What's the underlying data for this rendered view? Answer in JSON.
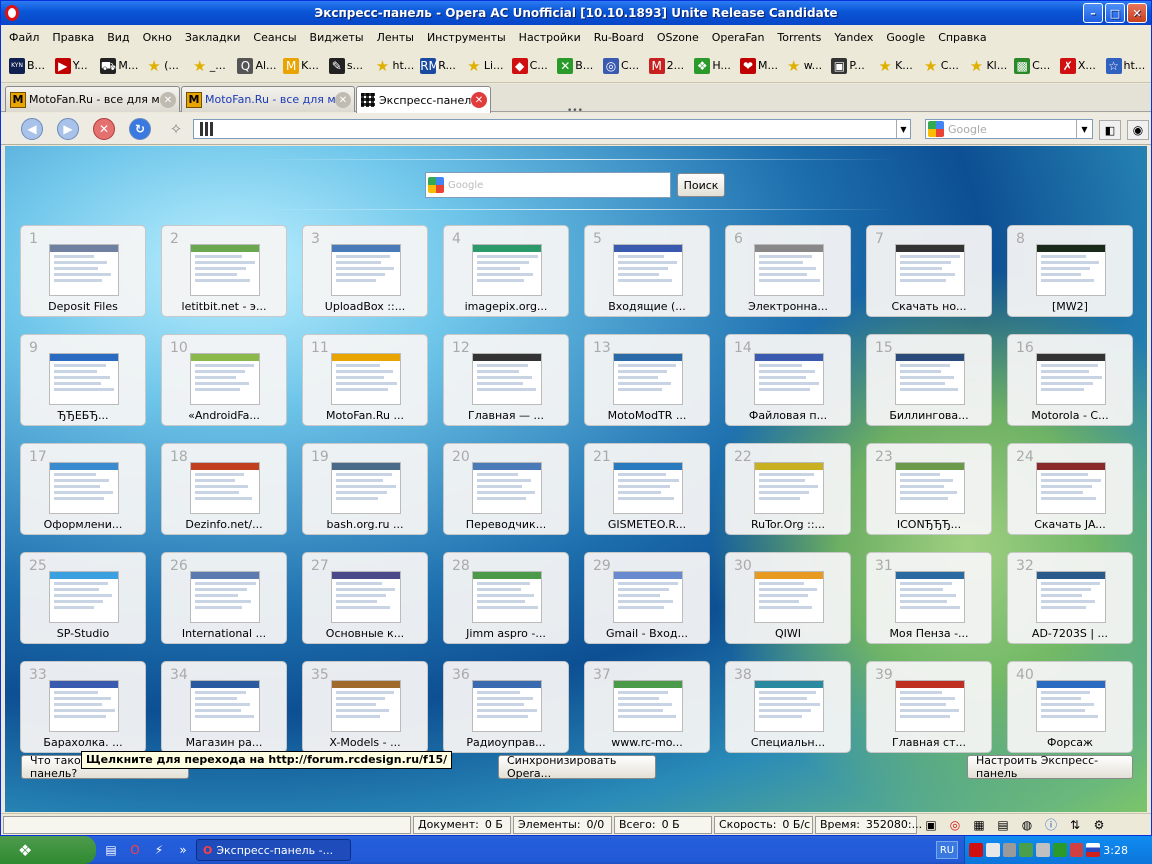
{
  "window": {
    "title": "Экспресс-панель - Opera AC Unofficial [10.10.1893] Unite Release Candidate",
    "minimize": "–",
    "maximize": "□",
    "close": "✕"
  },
  "menu": [
    "Файл",
    "Правка",
    "Вид",
    "Окно",
    "Закладки",
    "Сеансы",
    "Виджеты",
    "Ленты",
    "Инструменты",
    "Настройки",
    "Ru-Board",
    "OSzone",
    "OperaFan",
    "Torrents",
    "Yandex",
    "Google",
    "Справка"
  ],
  "bookmarks": [
    {
      "icon": "KYN",
      "label": "B...",
      "color": "#102050"
    },
    {
      "icon": "▶",
      "label": "Y...",
      "color": "#c00000"
    },
    {
      "icon": "⛟",
      "label": "M...",
      "color": "#222"
    },
    {
      "icon": "★",
      "label": "(...",
      "color": "#e0b000"
    },
    {
      "icon": "★",
      "label": "_...",
      "color": "#e0b000"
    },
    {
      "icon": "Q",
      "label": "Al...",
      "color": "#555"
    },
    {
      "icon": "M",
      "label": "K...",
      "color": "#e8a400"
    },
    {
      "icon": "✎",
      "label": "s...",
      "color": "#222"
    },
    {
      "icon": "★",
      "label": "ht...",
      "color": "#e0b000"
    },
    {
      "icon": "RM",
      "label": "R...",
      "color": "#1a4aa0"
    },
    {
      "icon": "★",
      "label": "Li...",
      "color": "#e0b000"
    },
    {
      "icon": "◆",
      "label": "C...",
      "color": "#d01010"
    },
    {
      "icon": "✕",
      "label": "B...",
      "color": "#2a9a2a"
    },
    {
      "icon": "◎",
      "label": "C...",
      "color": "#3a5ab0"
    },
    {
      "icon": "M",
      "label": "2...",
      "color": "#c82020"
    },
    {
      "icon": "❖",
      "label": "H...",
      "color": "#2a9a2a"
    },
    {
      "icon": "❤",
      "label": "M...",
      "color": "#c00000"
    },
    {
      "icon": "★",
      "label": "w...",
      "color": "#e0b000"
    },
    {
      "icon": "▣",
      "label": "P...",
      "color": "#333"
    },
    {
      "icon": "★",
      "label": "K...",
      "color": "#e0b000"
    },
    {
      "icon": "★",
      "label": "C...",
      "color": "#e0b000"
    },
    {
      "icon": "★",
      "label": "Kl...",
      "color": "#e0b000"
    },
    {
      "icon": "▩",
      "label": "C...",
      "color": "#2a8a2a"
    },
    {
      "icon": "✗",
      "label": "X...",
      "color": "#d01010"
    },
    {
      "icon": "☆",
      "label": "ht...",
      "color": "#3060c0"
    }
  ],
  "tabs": [
    {
      "label": "MotoFan.Ru - все для м...",
      "icon": "M"
    },
    {
      "label": "MotoFan.Ru - все для м...",
      "icon": "M"
    },
    {
      "label": "Экспресс-панель",
      "icon": "grid"
    }
  ],
  "address": {
    "value": ""
  },
  "search_bar": {
    "placeholder": "Google"
  },
  "speed_dial": {
    "search_placeholder": "Google",
    "search_button": "Поиск",
    "dials": [
      {
        "n": "1",
        "label": "Deposit Files",
        "c": "#7080a0"
      },
      {
        "n": "2",
        "label": "letitbit.net - э...",
        "c": "#6aa84f"
      },
      {
        "n": "3",
        "label": "UploadBox ::...",
        "c": "#4a7ab8"
      },
      {
        "n": "4",
        "label": "imagepix.org...",
        "c": "#2a9a6a"
      },
      {
        "n": "5",
        "label": "Входящие (...",
        "c": "#3a5ab0"
      },
      {
        "n": "6",
        "label": "Электронна...",
        "c": "#888"
      },
      {
        "n": "7",
        "label": "Скачать но...",
        "c": "#333"
      },
      {
        "n": "8",
        "label": "[MW2]",
        "c": "#1a2a1a"
      },
      {
        "n": "9",
        "label": "ЂЂЕБЂ...",
        "c": "#2a6ac0"
      },
      {
        "n": "10",
        "label": "«AndroidFa...",
        "c": "#8ab84a"
      },
      {
        "n": "11",
        "label": "MotoFan.Ru ...",
        "c": "#e8a400"
      },
      {
        "n": "12",
        "label": "Главная — ...",
        "c": "#333"
      },
      {
        "n": "13",
        "label": "MotoModTR ...",
        "c": "#2a6aa8"
      },
      {
        "n": "14",
        "label": "Файловая п...",
        "c": "#3a5ab0"
      },
      {
        "n": "15",
        "label": "Биллингова...",
        "c": "#2a4a7a"
      },
      {
        "n": "16",
        "label": "Motorola - С...",
        "c": "#333"
      },
      {
        "n": "17",
        "label": "Оформлени...",
        "c": "#3a8ad0"
      },
      {
        "n": "18",
        "label": "Dezinfo.net/...",
        "c": "#c04020"
      },
      {
        "n": "19",
        "label": "bash.org.ru ...",
        "c": "#4a6a8a"
      },
      {
        "n": "20",
        "label": "Переводчик...",
        "c": "#4a7ab8"
      },
      {
        "n": "21",
        "label": "GISMETEO.R...",
        "c": "#2a7ac0"
      },
      {
        "n": "22",
        "label": "RuTor.Org ::...",
        "c": "#c8b020"
      },
      {
        "n": "23",
        "label": "ICONЂЂЂ...",
        "c": "#6a9a4a"
      },
      {
        "n": "24",
        "label": "Скачать JA...",
        "c": "#8a2a2a"
      },
      {
        "n": "25",
        "label": "SP-Studio",
        "c": "#3aa0e0"
      },
      {
        "n": "26",
        "label": "International ...",
        "c": "#5a7ab0"
      },
      {
        "n": "27",
        "label": "Основные к...",
        "c": "#4a4a8a"
      },
      {
        "n": "28",
        "label": "Jimm aspro -...",
        "c": "#4a9a4a"
      },
      {
        "n": "29",
        "label": "Gmail - Вход...",
        "c": "#6a8ad0"
      },
      {
        "n": "30",
        "label": "QIWI",
        "c": "#e89a20"
      },
      {
        "n": "31",
        "label": "Моя Пенза -...",
        "c": "#2a6aa0"
      },
      {
        "n": "32",
        "label": "AD-7203S | ...",
        "c": "#2a5a8a"
      },
      {
        "n": "33",
        "label": "Барахолка. ...",
        "c": "#3a5ab0"
      },
      {
        "n": "34",
        "label": "Магазин ра...",
        "c": "#2a5aa0"
      },
      {
        "n": "35",
        "label": "X-Models - ...",
        "c": "#a06a2a"
      },
      {
        "n": "36",
        "label": "Радиоуправ...",
        "c": "#3a6ab0"
      },
      {
        "n": "37",
        "label": "www.rc-mo...",
        "c": "#4a9a4a"
      },
      {
        "n": "38",
        "label": "Специальн...",
        "c": "#2a8aa0"
      },
      {
        "n": "39",
        "label": "Главная ст...",
        "c": "#c03020"
      },
      {
        "n": "40",
        "label": "Форсаж",
        "c": "#2a6ac0"
      }
    ],
    "what_is": "Что такое Экспресс-панель?",
    "sync": "Синхронизировать Opera...",
    "configure": "Настроить Экспресс-панель",
    "tooltip": "Щелкните для перехода на http://forum.rcdesign.ru/f15/"
  },
  "status": {
    "document_label": "Документ:",
    "document_value": "0 Б",
    "elements_label": "Элементы:",
    "elements_value": "0/0",
    "total_label": "Всего:",
    "total_value": "0 Б",
    "speed_label": "Скорость:",
    "speed_value": "0 Б/с",
    "time_label": "Время:",
    "time_value": "352080:..."
  },
  "taskbar": {
    "task": "Экспресс-панель -...",
    "lang": "RU",
    "clock": "3:28"
  },
  "colors": {
    "title": "#0a56d6",
    "taskbar": "#245edb",
    "start": "#2f8a2f",
    "tray": "#0c75dc"
  }
}
